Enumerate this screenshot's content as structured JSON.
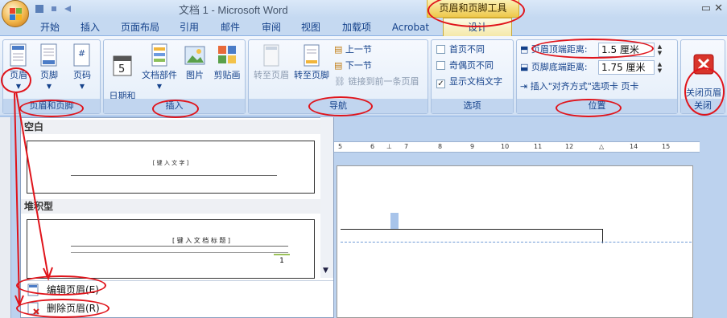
{
  "window": {
    "title": "文档 1 - Microsoft Word",
    "context_tab_title": "页眉和页脚工具"
  },
  "tabs": [
    "开始",
    "插入",
    "页面布局",
    "引用",
    "邮件",
    "审阅",
    "视图",
    "加载项",
    "Acrobat"
  ],
  "active_tab": "设计",
  "groups": {
    "header_footer": {
      "label": "页眉和页脚",
      "header": "页眉",
      "footer": "页脚",
      "page_number": "页码"
    },
    "insert": {
      "label": "插入",
      "datetime": "日期和\n时间",
      "quickparts": "文档部件",
      "picture": "图片",
      "clipart": "剪贴画"
    },
    "navigation": {
      "label": "导航",
      "goto_header": "转至页眉",
      "goto_footer": "转至页脚",
      "prev_section": "上一节",
      "next_section": "下一节",
      "link_previous": "链接到前一条页眉"
    },
    "options": {
      "label": "选项",
      "diff_first": "首页不同",
      "diff_odd_even": "奇偶页不同",
      "show_text": "显示文档文字",
      "show_text_checked": "✓"
    },
    "position": {
      "label": "位置",
      "header_dist_label": "页眉顶端距离:",
      "header_dist_value": "1.5 厘米",
      "footer_dist_label": "页脚底端距离:",
      "footer_dist_value": "1.75 厘米",
      "align_tab": "插入\"对齐方式\"选项卡 页卡"
    },
    "close": {
      "label": "关闭",
      "button": "关闭页眉\n和页脚"
    }
  },
  "dropdown": {
    "section1": "空白",
    "blank_thumb_text": "[ 键 入 文 字 ]",
    "section2": "堆积型",
    "stacked_thumb_text": "[ 键 入 文 档 标 题 ]",
    "stacked_thumb_num": "1",
    "edit_header": "编辑页眉(E)",
    "delete_header": "删除页眉(R)"
  },
  "ruler": [
    "5",
    "6",
    "7",
    "8",
    "9",
    "10",
    "11",
    "12",
    "14",
    "15"
  ],
  "colors": {
    "accent_red": "#e0141b",
    "ribbon_text": "#15428b",
    "context_tab": "#eec84c"
  }
}
